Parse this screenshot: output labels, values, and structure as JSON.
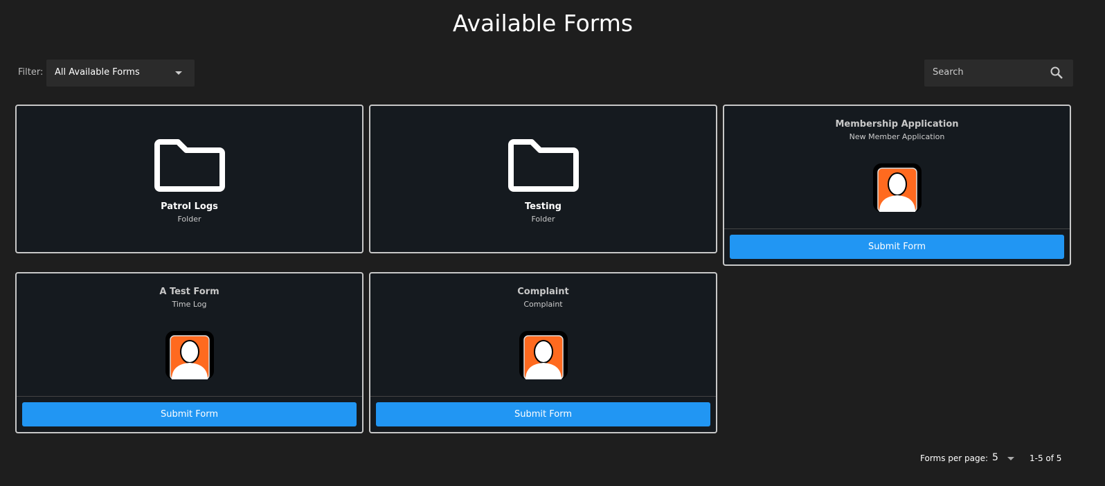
{
  "header": {
    "title": "Available Forms"
  },
  "filter": {
    "label": "Filter:",
    "value": "All Available Forms"
  },
  "search": {
    "placeholder": "Search"
  },
  "folders": [
    {
      "name": "Patrol Logs",
      "type": "Folder"
    },
    {
      "name": "Testing",
      "type": "Folder"
    }
  ],
  "forms": [
    {
      "name": "Membership Application",
      "description": "New Member Application",
      "button": "Submit Form"
    },
    {
      "name": "A Test Form",
      "description": "Time Log",
      "button": "Submit Form"
    },
    {
      "name": "Complaint",
      "description": "Complaint",
      "button": "Submit Form"
    }
  ],
  "pagination": {
    "per_page_label": "Forms per page:",
    "per_page": "5",
    "range": "1-5 of 5"
  },
  "colors": {
    "accent": "#2196f3",
    "avatar_bg": "#ff6a1f"
  }
}
